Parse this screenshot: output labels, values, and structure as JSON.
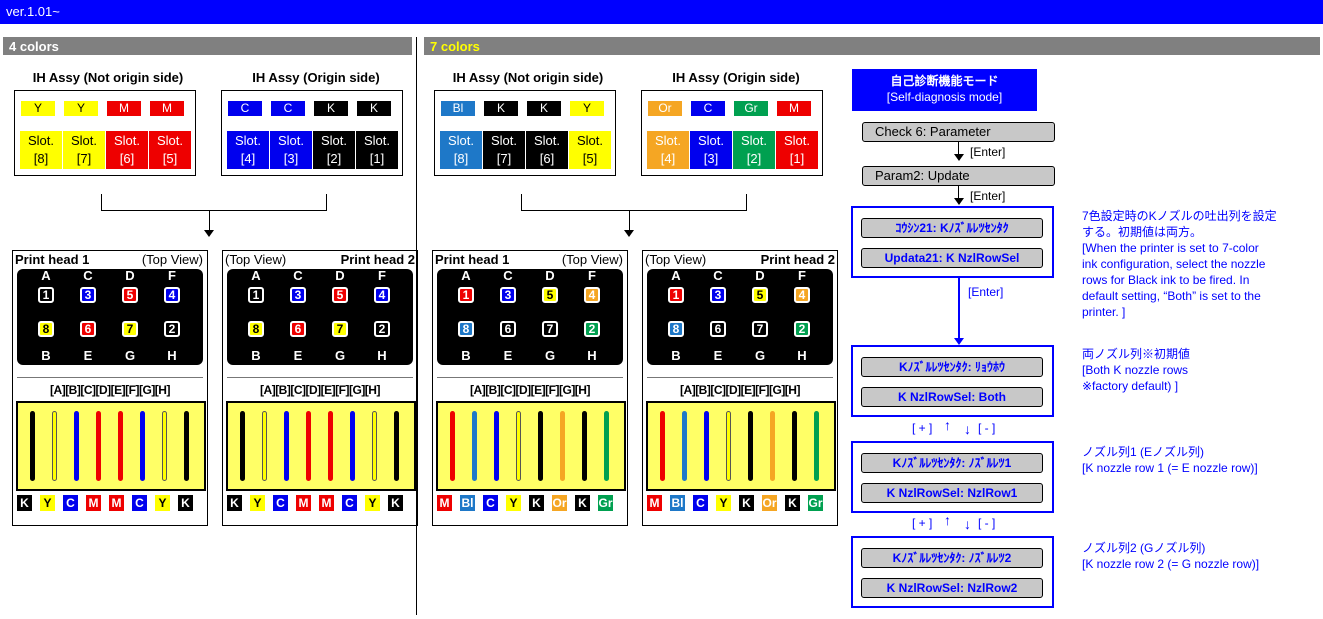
{
  "colors": {
    "Y": "#ffff00",
    "M": "#ee0000",
    "C": "#0000ee",
    "K": "#000000",
    "Bl": "#1e78c8",
    "Or": "#f5a623",
    "Gr": "#00a050",
    "white": "#ffffff",
    "black": "#000000"
  },
  "version": "ver.1.01~",
  "four": {
    "title": "4 colors",
    "assy_left_title": "IH Assy (Not origin side)",
    "assy_right_title": "IH Assy (Origin side)",
    "slots_left": [
      {
        "ink": "Y",
        "line1": "Slot.",
        "line2": "[8]"
      },
      {
        "ink": "Y",
        "line1": "Slot.",
        "line2": "[7]"
      },
      {
        "ink": "M",
        "line1": "Slot.",
        "line2": "[6]"
      },
      {
        "ink": "M",
        "line1": "Slot.",
        "line2": "[5]"
      }
    ],
    "slots_right": [
      {
        "ink": "C",
        "line1": "Slot.",
        "line2": "[4]"
      },
      {
        "ink": "C",
        "line1": "Slot.",
        "line2": "[3]"
      },
      {
        "ink": "K",
        "line1": "Slot.",
        "line2": "[2]"
      },
      {
        "ink": "K",
        "line1": "Slot.",
        "line2": "[1]"
      }
    ],
    "heads": [
      {
        "title": "Print head 1",
        "view": "(Top View)",
        "nozzles": [
          {
            "n": "1",
            "ink": "K"
          },
          {
            "n": "3",
            "ink": "C"
          },
          {
            "n": "5",
            "ink": "M"
          },
          {
            "n": "4",
            "ink": "C"
          },
          {
            "n": "8",
            "ink": "Y"
          },
          {
            "n": "6",
            "ink": "M"
          },
          {
            "n": "7",
            "ink": "Y"
          },
          {
            "n": "2",
            "ink": "K"
          }
        ],
        "cols": [
          "K",
          "Y",
          "C",
          "M",
          "M",
          "C",
          "Y",
          "K"
        ]
      },
      {
        "title": "Print head 2",
        "view": "(Top View)",
        "nozzles": [
          {
            "n": "1",
            "ink": "K"
          },
          {
            "n": "3",
            "ink": "C"
          },
          {
            "n": "5",
            "ink": "M"
          },
          {
            "n": "4",
            "ink": "C"
          },
          {
            "n": "8",
            "ink": "Y"
          },
          {
            "n": "6",
            "ink": "M"
          },
          {
            "n": "7",
            "ink": "Y"
          },
          {
            "n": "2",
            "ink": "K"
          }
        ],
        "cols": [
          "K",
          "Y",
          "C",
          "M",
          "M",
          "C",
          "Y",
          "K"
        ]
      }
    ]
  },
  "seven": {
    "title": "7 colors",
    "assy_left_title": "IH Assy (Not origin side)",
    "assy_right_title": "IH Assy (Origin side)",
    "slots_left": [
      {
        "ink": "Bl",
        "line1": "Slot.",
        "line2": "[8]"
      },
      {
        "ink": "K",
        "line1": "Slot.",
        "line2": "[7]"
      },
      {
        "ink": "K",
        "line1": "Slot.",
        "line2": "[6]"
      },
      {
        "ink": "Y",
        "line1": "Slot.",
        "line2": "[5]"
      }
    ],
    "slots_right": [
      {
        "ink": "Or",
        "line1": "Slot.",
        "line2": "[4]"
      },
      {
        "ink": "C",
        "line1": "Slot.",
        "line2": "[3]"
      },
      {
        "ink": "Gr",
        "line1": "Slot.",
        "line2": "[2]"
      },
      {
        "ink": "M",
        "line1": "Slot.",
        "line2": "[1]"
      }
    ],
    "heads": [
      {
        "title": "Print head 1",
        "view": "(Top View)",
        "nozzles": [
          {
            "n": "1",
            "ink": "M"
          },
          {
            "n": "3",
            "ink": "C"
          },
          {
            "n": "5",
            "ink": "Y"
          },
          {
            "n": "4",
            "ink": "Or"
          },
          {
            "n": "8",
            "ink": "Bl"
          },
          {
            "n": "6",
            "ink": "K"
          },
          {
            "n": "7",
            "ink": "K"
          },
          {
            "n": "2",
            "ink": "Gr"
          }
        ],
        "cols": [
          "M",
          "Bl",
          "C",
          "Y",
          "K",
          "Or",
          "K",
          "Gr"
        ]
      },
      {
        "title": "Print head 2",
        "view": "(Top View)",
        "nozzles": [
          {
            "n": "1",
            "ink": "M"
          },
          {
            "n": "3",
            "ink": "C"
          },
          {
            "n": "5",
            "ink": "Y"
          },
          {
            "n": "4",
            "ink": "Or"
          },
          {
            "n": "8",
            "ink": "Bl"
          },
          {
            "n": "6",
            "ink": "K"
          },
          {
            "n": "7",
            "ink": "K"
          },
          {
            "n": "2",
            "ink": "Gr"
          }
        ],
        "cols": [
          "M",
          "Bl",
          "C",
          "Y",
          "K",
          "Or",
          "K",
          "Gr"
        ]
      }
    ]
  },
  "letters_top": [
    "A",
    "C",
    "D",
    "F"
  ],
  "letters_bottom": [
    "B",
    "E",
    "G",
    "H"
  ],
  "col_title": "[A][B][C][D][E][F][G][H]",
  "flow": {
    "mode_title_jp": "自己診断機能モード",
    "mode_title_en": "[Self-diagnosis mode]",
    "check": "Check  6:  Parameter",
    "param": "Param2:  Update",
    "enter": "[Enter]",
    "box1": [
      "ｺｳｼﾝ21:     Kﾉｽﾞﾙﾚﾂｾﾝﾀｸ",
      "Updata21: K NzlRowSel"
    ],
    "box2": [
      "Kﾉｽﾞﾙﾚﾂｾﾝﾀｸ:          ﾘｮｳﾎｳ",
      "K NzlRowSel:          Both"
    ],
    "box3": [
      "Kﾉｽﾞﾙﾚﾂｾﾝﾀｸ:    ﾉｽﾞﾙﾚﾂ1",
      "K NzlRowSel:   NzlRow1"
    ],
    "box4": [
      "Kﾉｽﾞﾙﾚﾂｾﾝﾀｸ:    ﾉｽﾞﾙﾚﾂ2",
      "K NzlRowSel:   NzlRow2"
    ],
    "plus": "[ + ]",
    "minus": "[ - ]",
    "note1": [
      "7色設定時のKノズルの吐出列を設定",
      "する。初期値は両方。",
      "[When the printer is set to 7-color",
      "ink configuration, select the nozzle",
      "rows for Black ink to be fired. In",
      "default setting, “Both” is set to the",
      "printer. ]"
    ],
    "note2": [
      "両ノズル列※初期値",
      "[Both K nozzle rows",
      "※factory default) ]"
    ],
    "note3": [
      "ノズル列1 (Eノズル列)",
      "[K nozzle row 1 (= E nozzle row)]"
    ],
    "note4": [
      "ノズル列2 (Gノズル列)",
      "[K nozzle row 2 (= G nozzle row)]"
    ]
  }
}
